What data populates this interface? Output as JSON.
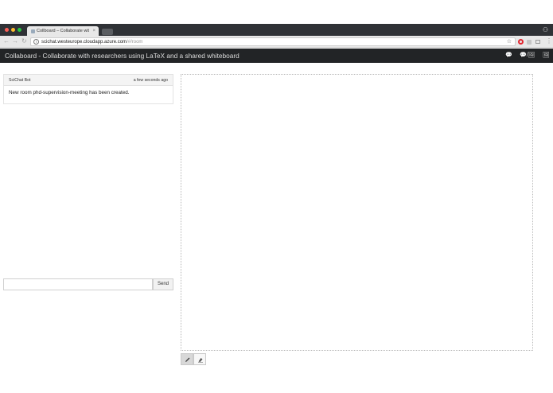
{
  "browser": {
    "tab_title": "Collboard – Collaborate with…",
    "tab_close": "×",
    "url_host": "scichat.westeurope.cloudapp.azure.com",
    "url_path": "/#/room",
    "info_glyph": "i",
    "star_glyph": "☆",
    "menu_glyph": "⋮",
    "profile_glyph": "⚇",
    "back_glyph": "←",
    "forward_glyph": "→",
    "reload_glyph": "↻"
  },
  "navbar": {
    "title": "Collaboard - Collaborate with researchers using LaTeX and a shared whiteboard",
    "chat_glyph": "💬",
    "split_glyph": "💬/🖼",
    "board_glyph": "🖼"
  },
  "chat": {
    "messages": [
      {
        "author": "SciChat Bot",
        "time": "a few seconds ago",
        "text": "New room phd-supervision-meeting has been created."
      }
    ],
    "input_value": "",
    "send_label": "Send"
  },
  "whiteboard": {
    "tools": [
      {
        "name": "pen",
        "active": true
      },
      {
        "name": "eraser",
        "active": false
      }
    ]
  },
  "colors": {
    "navbar_bg": "#222426",
    "tabstrip_bg": "#2f3236",
    "close_red": "#fc5f57",
    "minimize_yellow": "#fdbc2e",
    "zoom_green": "#28c840"
  }
}
